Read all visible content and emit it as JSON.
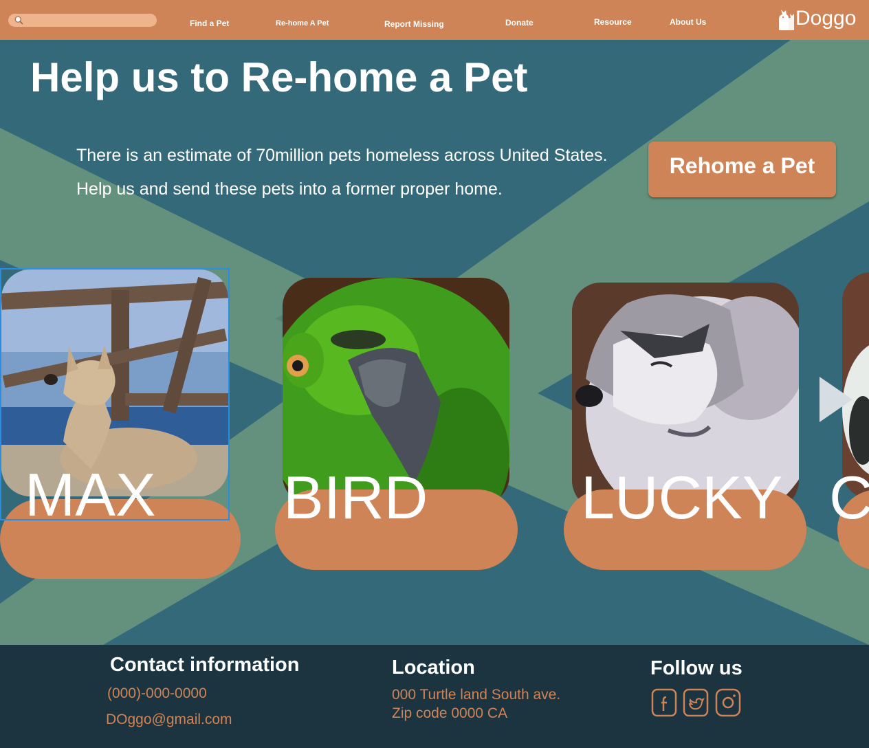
{
  "search": {
    "placeholder": ""
  },
  "nav": [
    {
      "label": "Find a Pet"
    },
    {
      "label": "Re-home A Pet"
    },
    {
      "label": "Report Missing"
    },
    {
      "label": "Donate"
    },
    {
      "label": "Resource"
    },
    {
      "label": "About Us"
    }
  ],
  "brand": {
    "name": "Doggo",
    "icon": "dog-cat-logo-icon"
  },
  "hero": {
    "title": "Help us to Re-home a Pet",
    "text_line1": "There is an estimate of 70million pets homeless across United States.",
    "text_line2": "Help us and send these pets into a former proper home.",
    "button_label": "Rehome a Pet"
  },
  "pets": [
    {
      "name": "MAX"
    },
    {
      "name": "BIRD"
    },
    {
      "name": "LUCKY"
    },
    {
      "name": "C"
    }
  ],
  "footer": {
    "contact": {
      "heading": "Contact information",
      "phone": "(000)-000-0000",
      "email": "DOggo@gmail.com"
    },
    "location": {
      "heading": "Location",
      "line1": "000 Turtle land South ave.",
      "line2": "Zip code 0000 CA"
    },
    "follow": {
      "heading": "Follow us",
      "icons": [
        "facebook-icon",
        "twitter-icon",
        "instagram-icon"
      ]
    }
  },
  "colors": {
    "header": "#cf8457",
    "hero_bg": "#34697a",
    "hero_stripe": "#63917e",
    "footer_bg": "#1c3440",
    "accent_text": "#cf8457"
  }
}
